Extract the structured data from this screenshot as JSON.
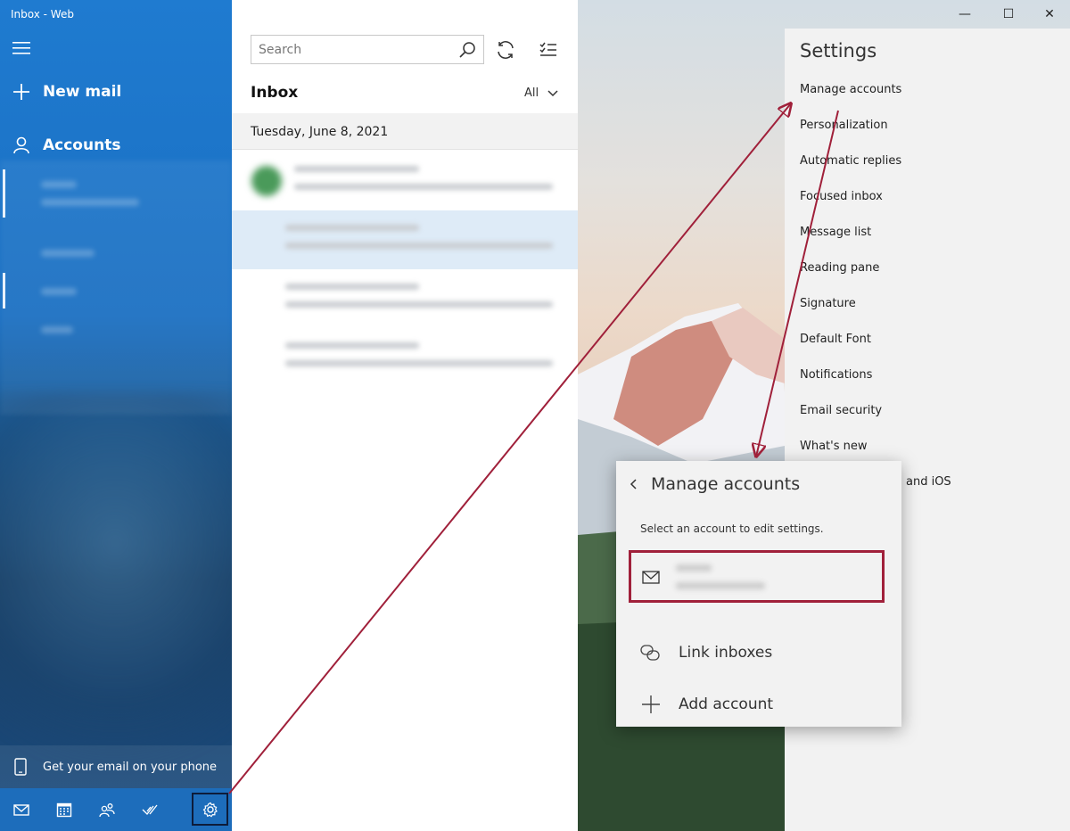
{
  "window": {
    "title": "Inbox - Web",
    "controls": {
      "minimize": "—",
      "maximize": "☐",
      "close": "✕"
    }
  },
  "sidebar": {
    "menu_icon": "hamburger-icon",
    "new_mail": "New mail",
    "accounts": "Accounts",
    "phone_promo": "Get your email on your phone",
    "bottom_nav": [
      "mail-icon",
      "calendar-icon",
      "people-icon",
      "todo-icon",
      "gear-icon"
    ]
  },
  "maillist": {
    "search_placeholder": "Search",
    "title": "Inbox",
    "filter": "All",
    "date_header": "Tuesday, June 8, 2021"
  },
  "settings": {
    "title": "Settings",
    "items": [
      "Manage accounts",
      "Personalization",
      "Automatic replies",
      "Focused inbox",
      "Message list",
      "Reading pane",
      "Signature",
      "Default Font",
      "Notifications",
      "Email security",
      "What's new"
    ],
    "partial_item": "and iOS"
  },
  "manage_accounts": {
    "title": "Manage accounts",
    "description": "Select an account to edit settings.",
    "link_inboxes": "Link inboxes",
    "add_account": "Add account"
  },
  "colors": {
    "accent": "#1f7bd0",
    "annotation": "#a0203a",
    "panel": "#f2f2f2"
  }
}
